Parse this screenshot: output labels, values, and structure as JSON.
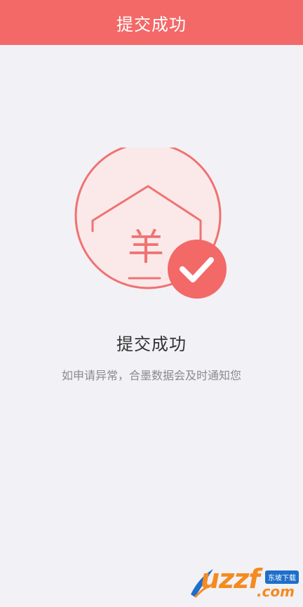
{
  "header": {
    "title": "提交成功"
  },
  "illustration": {
    "glyph": "羊",
    "icons": [
      "house-icon",
      "check-circle-icon"
    ]
  },
  "main": {
    "title": "提交成功",
    "message": "如申请异常，合墨数据会及时通知您"
  },
  "watermark": {
    "logo_text": "uzzf",
    "badge": "东坡下载",
    "domain": ".com"
  },
  "colors": {
    "accent": "#f26968",
    "background": "#f2f1f5",
    "circle_fill": "#fbe9e9"
  }
}
